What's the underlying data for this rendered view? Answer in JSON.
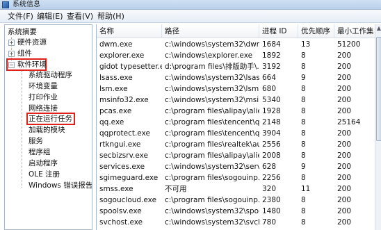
{
  "window": {
    "title": "系统信息"
  },
  "menubar": [
    {
      "label": "文件(F)"
    },
    {
      "label": "编辑(E)"
    },
    {
      "label": "查看(V)"
    },
    {
      "label": "帮助(H)"
    }
  ],
  "tree": {
    "root": "系统摘要",
    "items": [
      {
        "label": "硬件资源",
        "expander": "+"
      },
      {
        "label": "组件",
        "expander": "+"
      },
      {
        "label": "软件环境",
        "expander": "−"
      },
      {
        "label": "系统驱动程序"
      },
      {
        "label": "环境变量"
      },
      {
        "label": "打印作业"
      },
      {
        "label": "网络连接"
      },
      {
        "label": "正在运行任务"
      },
      {
        "label": "加载的模块"
      },
      {
        "label": "服务"
      },
      {
        "label": "程序组"
      },
      {
        "label": "启动程序"
      },
      {
        "label": "OLE 注册"
      },
      {
        "label": "Windows 错误报告"
      }
    ]
  },
  "table": {
    "columns": [
      "名称",
      "路径",
      "进程 ID",
      "优先顺序",
      "最小工作集"
    ],
    "rows": [
      [
        "dwm.exe",
        "c:\\windows\\system32\\dwm...",
        "1684",
        "13",
        "51200"
      ],
      [
        "explorer.exe",
        "c:\\windows\\explorer.exe",
        "1892",
        "8",
        "200"
      ],
      [
        "gidot typesetter.e...",
        "d:\\program files\\排版助手\\...",
        "3192",
        "8",
        "200"
      ],
      [
        "lsass.exe",
        "c:\\windows\\system32\\lsass...",
        "664",
        "9",
        "200"
      ],
      [
        "lsm.exe",
        "c:\\windows\\system32\\lsm.e...",
        "680",
        "8",
        "200"
      ],
      [
        "msinfo32.exe",
        "c:\\windows\\system32\\msin...",
        "5340",
        "8",
        "200"
      ],
      [
        "pcas.exe",
        "c:\\program files\\alipay\\alie...",
        "1928",
        "8",
        "200"
      ],
      [
        "qq.exe",
        "c:\\program files\\tencent\\q...",
        "2148",
        "8",
        "25164"
      ],
      [
        "qqprotect.exe",
        "c:\\program files\\tencent\\q...",
        "3904",
        "8",
        "200"
      ],
      [
        "rtkngui.exe",
        "c:\\program files\\realtek\\au...",
        "2556",
        "8",
        "200"
      ],
      [
        "secbizsrv.exe",
        "c:\\program files\\alipay\\alie...",
        "2008",
        "8",
        "200"
      ],
      [
        "services.exe",
        "c:\\windows\\system32\\servi...",
        "628",
        "9",
        "200"
      ],
      [
        "sgimeguard.exe",
        "c:\\program files\\sogouinp...",
        "2256",
        "8",
        "200"
      ],
      [
        "smss.exe",
        "不可用",
        "320",
        "11",
        "200"
      ],
      [
        "sogoucloud.exe",
        "c:\\program files\\sogouinp...",
        "2380",
        "8",
        "200"
      ],
      [
        "spoolsv.exe",
        "c:\\windows\\system32\\spoo...",
        "1480",
        "8",
        "200"
      ],
      [
        "svchost.exe",
        "c:\\windows\\system32\\svch...",
        "780",
        "8",
        "200"
      ]
    ]
  }
}
